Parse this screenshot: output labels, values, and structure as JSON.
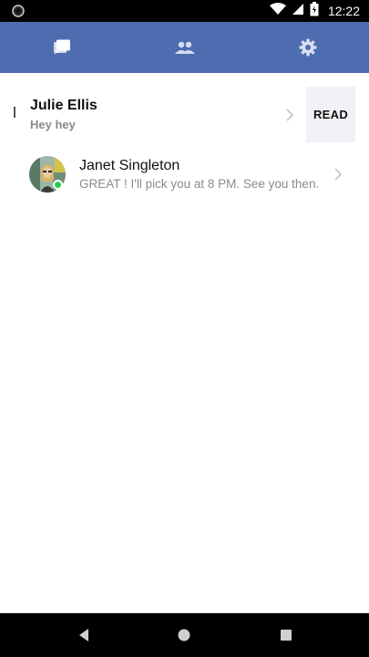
{
  "status_bar": {
    "time": "12:22",
    "icons": [
      "camera-notification-icon",
      "wifi-icon",
      "cell-signal-icon",
      "battery-icon"
    ]
  },
  "tabs": [
    {
      "name": "messages",
      "icon": "chat-bubble-icon",
      "active": true
    },
    {
      "name": "contacts",
      "icon": "people-icon",
      "active": false
    },
    {
      "name": "settings",
      "icon": "gear-icon",
      "active": false
    }
  ],
  "colors": {
    "header": "#4e6cb0",
    "online": "#2ecc4e",
    "preview_text": "#8a8a8a",
    "action_bg": "#f1f2f6"
  },
  "conversations": [
    {
      "name": "Julie Ellis",
      "preview": "Hey hey",
      "unread": true,
      "swipe_action": "READ"
    },
    {
      "name": "Janet Singleton",
      "preview": "GREAT ! I'll pick you at 8 PM. See you then.",
      "unread": false,
      "online": true
    }
  ],
  "nav_bar": {
    "buttons": [
      "back-icon",
      "home-icon",
      "recents-icon"
    ]
  }
}
